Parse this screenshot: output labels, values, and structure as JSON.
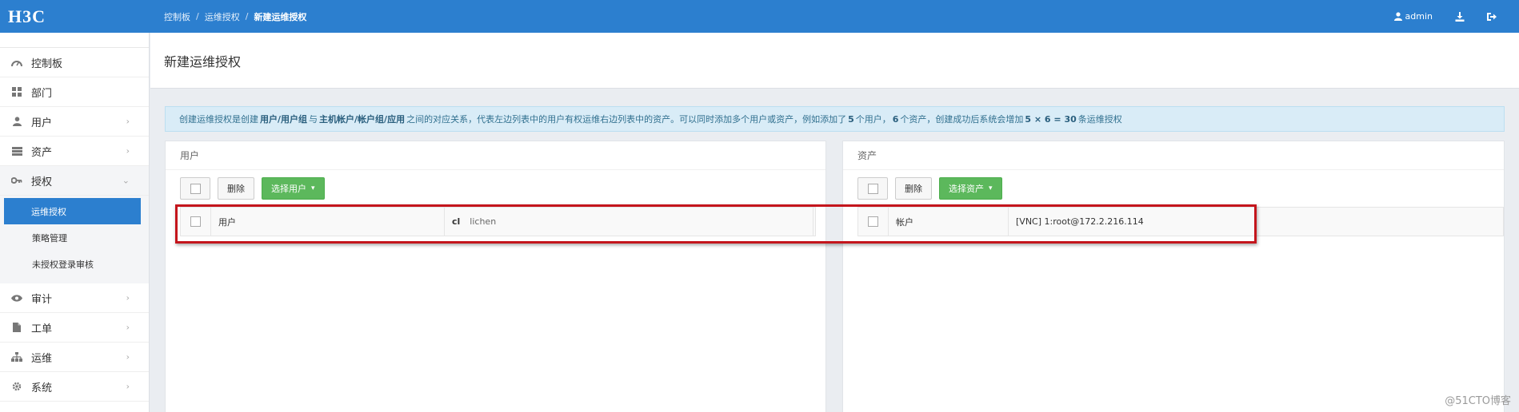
{
  "header": {
    "logo": "H3C",
    "breadcrumb": [
      "控制板",
      "运维授权",
      "新建运维授权"
    ],
    "breadcrumb_sep": "/",
    "username": "admin",
    "icons": [
      "user-icon",
      "download-icon",
      "logout-icon"
    ]
  },
  "sidebar": {
    "items": [
      {
        "label": "控制板",
        "icon": "dashboard-icon"
      },
      {
        "label": "部门",
        "icon": "grid-icon"
      },
      {
        "label": "用户",
        "icon": "user-icon",
        "chevron": "›"
      },
      {
        "label": "资产",
        "icon": "asset-icon",
        "chevron": "›"
      },
      {
        "label": "授权",
        "icon": "key-icon",
        "chevron": "⌄"
      },
      {
        "label": "审计",
        "icon": "eye-icon",
        "chevron": "›"
      },
      {
        "label": "工单",
        "icon": "document-icon",
        "chevron": "›"
      },
      {
        "label": "运维",
        "icon": "sitemap-icon",
        "chevron": "›"
      },
      {
        "label": "系统",
        "icon": "gear-icon",
        "chevron": "›"
      }
    ],
    "auth_sub_items": [
      "运维授权",
      "策略管理",
      "未授权登录审核"
    ]
  },
  "main": {
    "page_title": "新建运维授权",
    "info": {
      "t1": "创建运维授权是创建",
      "b1": "用户/用户组",
      "t2": "与",
      "b2": "主机帐户/帐户组/应用",
      "t3": "之间的对应关系，代表左边列表中的用户有权运维右边列表中的资产。可以同时添加多个用户或资产，例如添加了",
      "b3": "5",
      "t4": "个用户，",
      "b4": "6",
      "t5": "个资产，创建成功后系统会增加",
      "b5": "5 × 6 = 30",
      "t6": "条运维授权"
    },
    "left_panel": {
      "title": "用户",
      "delete_label": "删除",
      "select_label": "选择用户",
      "row": {
        "label": "用户",
        "id": "cl",
        "name": "lichen"
      }
    },
    "right_panel": {
      "title": "资产",
      "delete_label": "删除",
      "select_label": "选择资产",
      "row": {
        "label": "帐户",
        "value": "[VNC] 1:root@172.2.216.114"
      }
    }
  },
  "watermark": "@51CTO博客",
  "colors": {
    "primary": "#2c7fcf",
    "success": "#5cb85c",
    "info_bg": "#d9ecf7",
    "highlight": "#c4151c"
  }
}
